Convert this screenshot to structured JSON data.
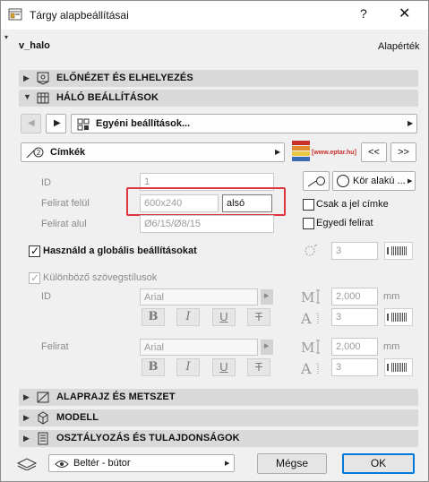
{
  "window": {
    "title": "Tárgy alapbeállításai",
    "help": "?",
    "close": "✕"
  },
  "header": {
    "object_name": "v_halo",
    "default_label": "Alapérték"
  },
  "sections": {
    "preview": "ELŐNÉZET ÉS ELHELYEZÉS",
    "mesh": "HÁLÓ BEÁLLÍTÁSOK",
    "floorplan": "ALAPRAJZ ÉS METSZET",
    "model": "MODELL",
    "classification": "OSZTÁLYOZÁS ÉS TULAJDONSÁGOK"
  },
  "custom_settings": {
    "label": "Egyéni beállítások..."
  },
  "labels_row": {
    "label": "Címkék",
    "logo_text": "[www.eptar.hu]",
    "prev": "<<",
    "next": ">>"
  },
  "fields": {
    "id_label": "ID",
    "id_value": "1",
    "top_label": "Felirat felül",
    "top_value": "600x240",
    "top_suffix": "alsó",
    "bottom_label": "Felirat alul",
    "bottom_value": "Ø6/15/Ø8/15"
  },
  "shape_dropdown": "Kör alakú ...",
  "options": {
    "only_marker": "Csak a jel címke",
    "individual": "Egyedi felirat"
  },
  "global": {
    "label": "Használd a globális beállításokat",
    "value": "3"
  },
  "styles": {
    "label": "Különböző szövegstílusok",
    "id_label": "ID",
    "id_font": "Arial",
    "id_size": "2,000",
    "id_unit": "mm",
    "id_pen": "3",
    "text_label": "Felirat",
    "text_font": "Arial",
    "text_size": "2,000",
    "text_unit": "mm",
    "text_pen": "3",
    "bold": "B",
    "italic": "I",
    "underline": "U",
    "strike": "T"
  },
  "footer": {
    "layer": "Beltér - bútor",
    "cancel": "Mégse",
    "ok": "OK"
  },
  "colors": {
    "highlight": "#e0343f",
    "ok_border": "#0078d7",
    "section_bg": "#d9d9d9"
  }
}
